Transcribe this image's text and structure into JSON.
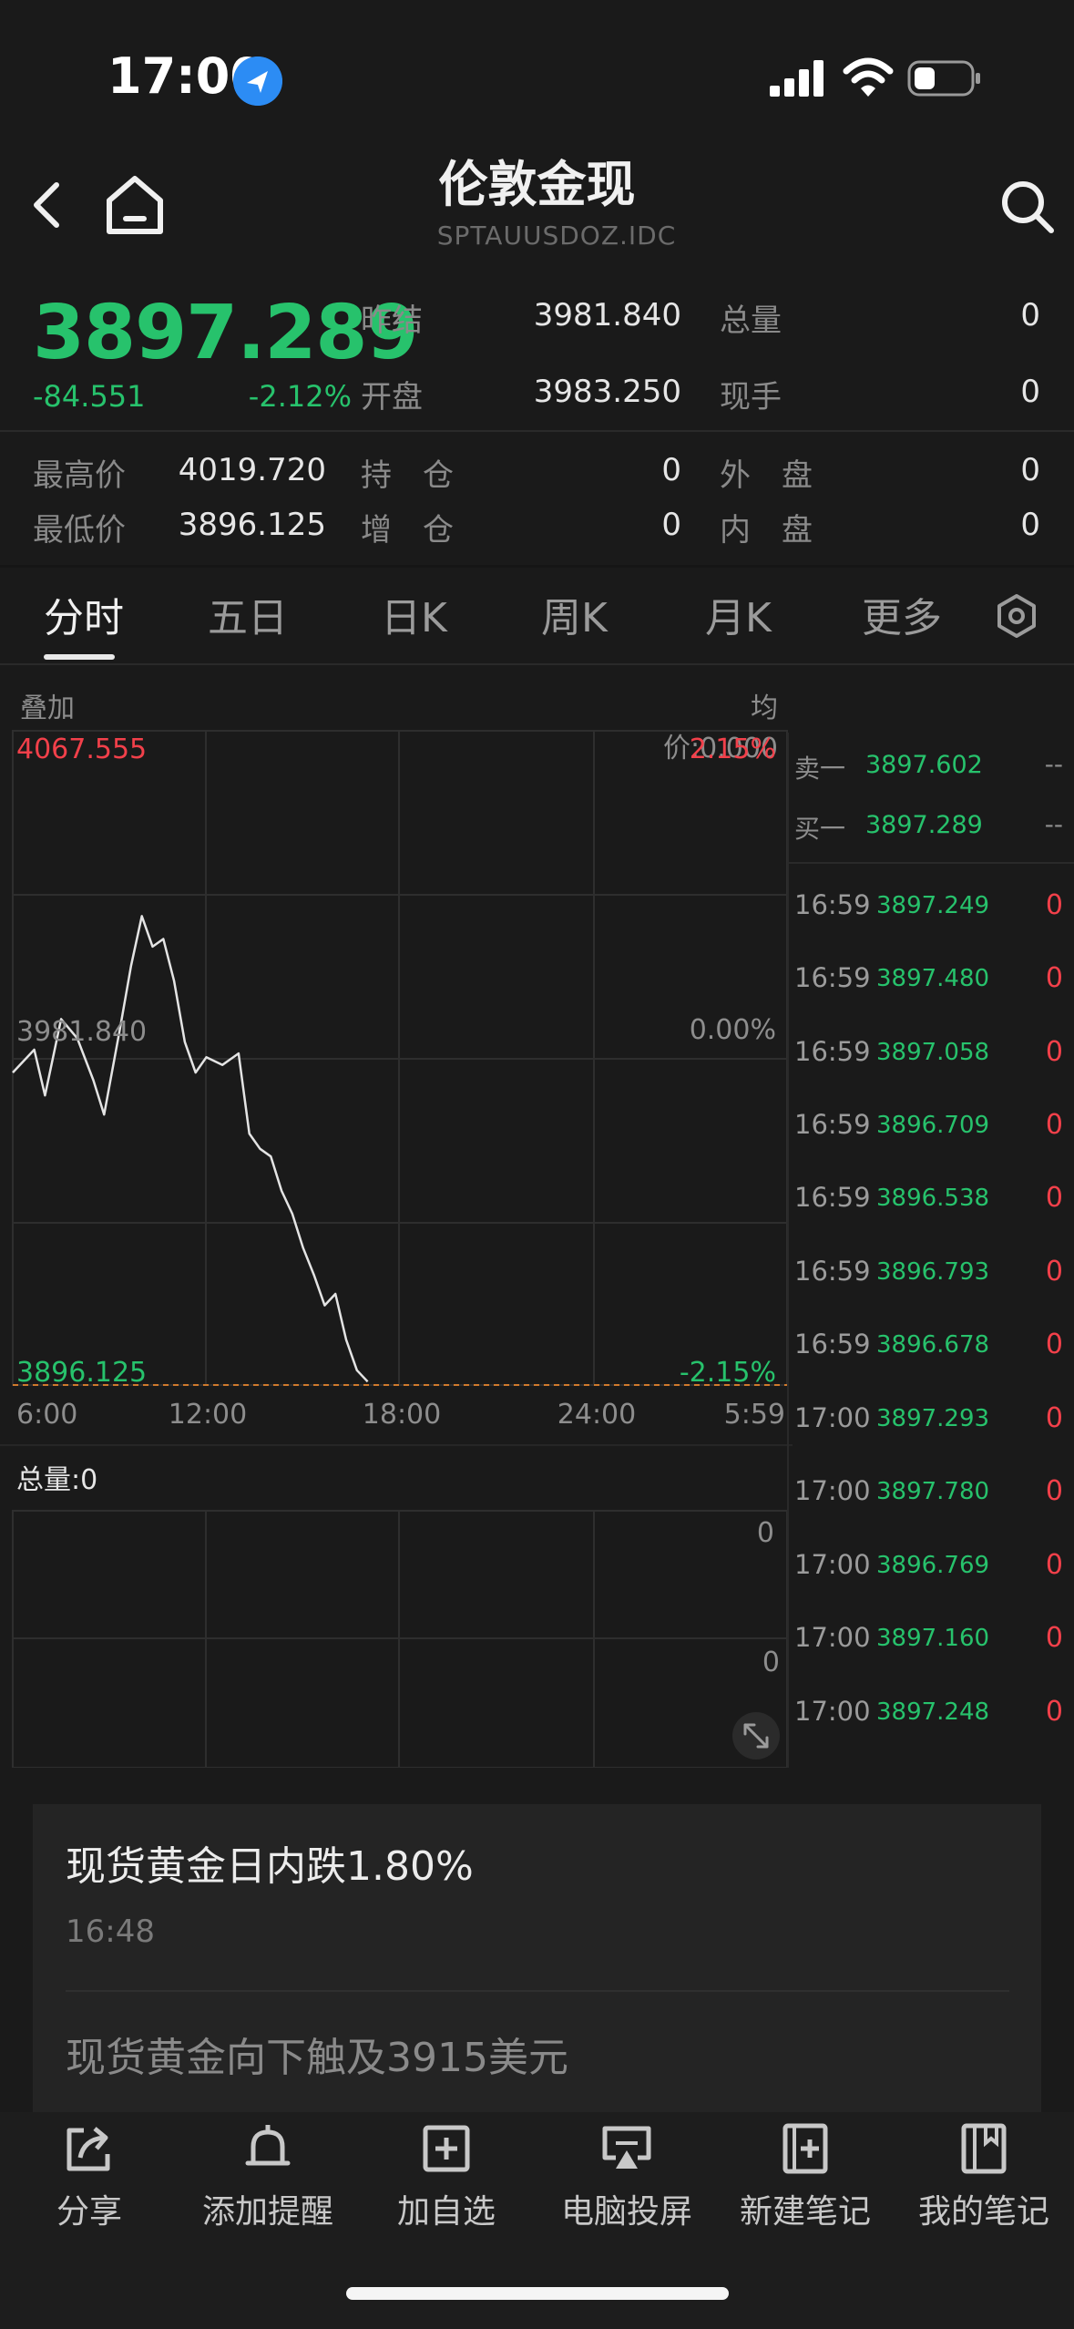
{
  "status_bar": {
    "time": "17:00"
  },
  "header": {
    "title": "伦敦金现",
    "subtitle": "SPTAUUSDOZ.IDC"
  },
  "quote": {
    "last": "3897.289",
    "change": "-84.551",
    "change_pct": "-2.12%",
    "fields": {
      "prev_settle_label": "昨结",
      "prev_settle": "3981.840",
      "open_label": "开盘",
      "open": "3983.250",
      "total_vol_label": "总量",
      "total_vol": "0",
      "cur_hand_label": "现手",
      "cur_hand": "0",
      "high_label": "最高价",
      "high": "4019.720",
      "low_label": "最低价",
      "low": "3896.125",
      "hold_label": "持 仓",
      "hold": "0",
      "add_label": "增 仓",
      "add": "0",
      "outer_label": "外 盘",
      "outer": "0",
      "inner_label": "内 盘",
      "inner": "0"
    }
  },
  "tabs": [
    "分时",
    "五日",
    "日K",
    "周K",
    "月K",
    "更多"
  ],
  "chart": {
    "overlay_label": "叠加",
    "avg_price": "均价:0.000",
    "max_price": "4067.555",
    "max_pct": "2.15%",
    "ref_price": "3981.840",
    "ref_pct": "0.00%",
    "min_price": "3896.125",
    "min_pct": "-2.15%",
    "x_ticks": [
      "6:00",
      "12:00",
      "18:00",
      "24:00",
      "5:59"
    ],
    "volume_label": "总量:0",
    "volume_ticks": [
      "0",
      "0"
    ]
  },
  "order_book": {
    "sell1_label": "卖一",
    "sell1_price": "3897.602",
    "sell1_vol": "--",
    "buy1_label": "买一",
    "buy1_price": "3897.289",
    "buy1_vol": "--"
  },
  "ticks": [
    {
      "time": "16:59",
      "price": "3897.249",
      "vol": "0"
    },
    {
      "time": "16:59",
      "price": "3897.480",
      "vol": "0"
    },
    {
      "time": "16:59",
      "price": "3897.058",
      "vol": "0"
    },
    {
      "time": "16:59",
      "price": "3896.709",
      "vol": "0"
    },
    {
      "time": "16:59",
      "price": "3896.538",
      "vol": "0"
    },
    {
      "time": "16:59",
      "price": "3896.793",
      "vol": "0"
    },
    {
      "time": "16:59",
      "price": "3896.678",
      "vol": "0"
    },
    {
      "time": "17:00",
      "price": "3897.293",
      "vol": "0"
    },
    {
      "time": "17:00",
      "price": "3897.780",
      "vol": "0"
    },
    {
      "time": "17:00",
      "price": "3896.769",
      "vol": "0"
    },
    {
      "time": "17:00",
      "price": "3897.160",
      "vol": "0"
    },
    {
      "time": "17:00",
      "price": "3897.248",
      "vol": "0"
    }
  ],
  "news": [
    {
      "title": "现货黄金日内跌1.80%",
      "time": "16:48"
    },
    {
      "title": "现货黄金向下触及3915美元"
    }
  ],
  "toolbar": [
    "分享",
    "添加提醒",
    "加自选",
    "电脑投屏",
    "新建笔记",
    "我的笔记"
  ],
  "chart_data": {
    "type": "line",
    "x_range": [
      "6:00",
      "5:59"
    ],
    "x_tick_labels": [
      "6:00",
      "12:00",
      "18:00",
      "24:00",
      "5:59"
    ],
    "y_range": [
      3896.125,
      4067.555
    ],
    "reference": 3981.84,
    "series": [
      {
        "x": [
          "6:00",
          "6:40",
          "7:00",
          "7:30",
          "8:00",
          "8:30",
          "8:50",
          "9:20",
          "9:40",
          "10:00",
          "10:20",
          "10:40",
          "11:00",
          "11:20",
          "11:40",
          "12:00",
          "12:30",
          "13:00",
          "13:20",
          "13:40",
          "14:00",
          "14:20",
          "14:40",
          "15:00",
          "15:20",
          "15:40",
          "16:00",
          "16:20",
          "16:40",
          "17:00"
        ],
        "values": [
          3978,
          3984,
          3972,
          3992,
          3987,
          3976,
          3967,
          3990,
          4006,
          4019,
          4011,
          4013,
          4002,
          3986,
          3978,
          3982,
          3980,
          3983,
          3962,
          3958,
          3956,
          3947,
          3941,
          3932,
          3925,
          3917,
          3920,
          3908,
          3900,
          3897
        ]
      }
    ]
  }
}
